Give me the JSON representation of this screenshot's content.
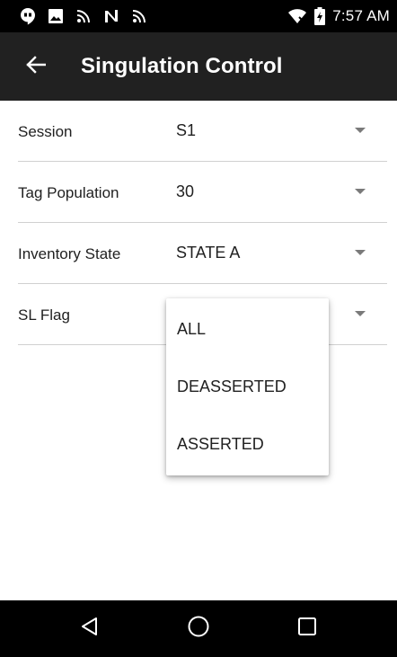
{
  "status_bar": {
    "time": "7:57 AM",
    "icons": [
      "hangouts-icon",
      "image-icon",
      "nfc-icon",
      "n-icon",
      "nfc-icon",
      "wifi-x-icon",
      "battery-charging-icon"
    ]
  },
  "app_bar": {
    "title": "Singulation Control",
    "back_icon": "arrow-back-icon"
  },
  "settings": [
    {
      "label": "Session",
      "value": "S1"
    },
    {
      "label": "Tag Population",
      "value": "30"
    },
    {
      "label": "Inventory State",
      "value": "STATE A"
    },
    {
      "label": "SL Flag",
      "value": ""
    }
  ],
  "popup_menu": {
    "items": [
      "ALL",
      "DEASSERTED",
      "ASSERTED"
    ]
  },
  "nav_bar": {
    "icons": [
      "back-triangle-icon",
      "home-circle-icon",
      "recents-square-icon"
    ]
  },
  "colors": {
    "app_bar": "#212121",
    "status_bar": "#000000",
    "nav_bar": "#000000",
    "divider": "#d0d0d0",
    "arrow": "#7a7a7a"
  }
}
